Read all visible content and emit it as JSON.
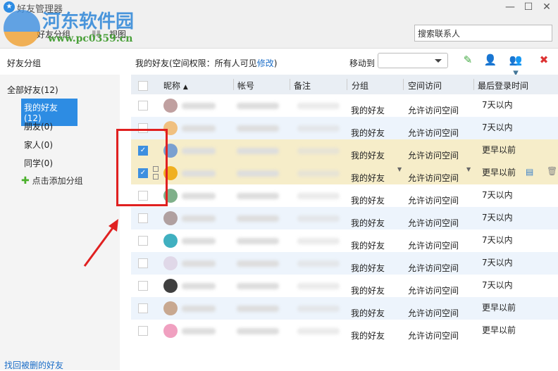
{
  "window": {
    "title": "好友管理器",
    "minimize": "—",
    "maximize": "☐",
    "close": "✕"
  },
  "watermark": {
    "name": "河东软件园",
    "url": "www.pc0359.cn"
  },
  "toolbar": {
    "groups": "好友分组",
    "view": "视图",
    "search_placeholder": "搜索联系人"
  },
  "sidebar": {
    "heading": "好友分组",
    "all": "全部好友(12)",
    "groups": [
      "我的好友 (12)",
      "朋友(0)",
      "家人(0)",
      "同学(0)"
    ],
    "add": "点击添加分组",
    "restore": "找回被删的好友"
  },
  "main": {
    "perm_prefix": "我的好友(空间权限：所有人可见",
    "perm_link": "修改",
    "perm_suffix": ")",
    "move_to": "移动到"
  },
  "columns": [
    "昵称",
    "帐号",
    "备注",
    "分组",
    "空间访问",
    "最后登录时间"
  ],
  "rows": [
    {
      "group": "我的好友",
      "access": "允许访问空间",
      "last": "7天以内",
      "checked": false,
      "color": "#c0a0a0"
    },
    {
      "group": "我的好友",
      "access": "允许访问空间",
      "last": "7天以内",
      "checked": false,
      "color": "#f0c080"
    },
    {
      "group": "我的好友",
      "access": "允许访问空间",
      "last": "更早以前",
      "checked": true,
      "color": "#7aa0d0"
    },
    {
      "group": "我的好友",
      "access": "允许访问空间",
      "last": "更早以前",
      "checked": true,
      "color": "#f0b020"
    },
    {
      "group": "我的好友",
      "access": "允许访问空间",
      "last": "7天以内",
      "checked": false,
      "color": "#7fb08a"
    },
    {
      "group": "我的好友",
      "access": "允许访问空间",
      "last": "7天以内",
      "checked": false,
      "color": "#b0a0a0"
    },
    {
      "group": "我的好友",
      "access": "允许访问空间",
      "last": "7天以内",
      "checked": false,
      "color": "#40b0c0"
    },
    {
      "group": "我的好友",
      "access": "允许访问空间",
      "last": "7天以内",
      "checked": false,
      "color": "#e0d8e8"
    },
    {
      "group": "我的好友",
      "access": "允许访问空间",
      "last": "7天以内",
      "checked": false,
      "color": "#404040"
    },
    {
      "group": "我的好友",
      "access": "允许访问空间",
      "last": "更早以前",
      "checked": false,
      "color": "#c8a890"
    },
    {
      "group": "我的好友",
      "access": "允许访问空间",
      "last": "更早以前",
      "checked": false,
      "color": "#f0a0c0"
    }
  ]
}
